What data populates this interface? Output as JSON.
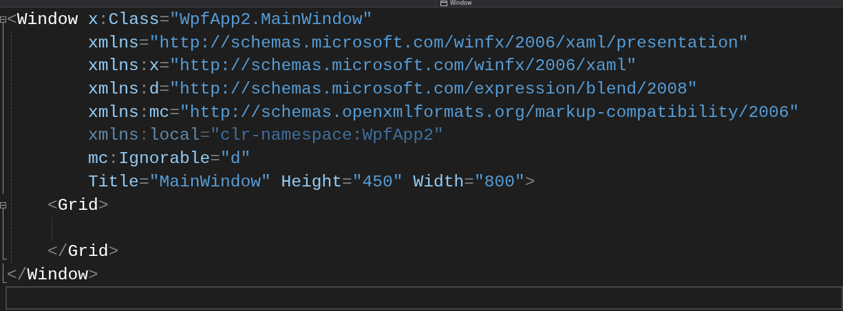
{
  "navigation_bar": {
    "member_dropdown": "Window"
  },
  "editor": {
    "lines": [
      {
        "kind": "root",
        "fold_marker": true,
        "region_end": false,
        "current": false,
        "dimmed": false,
        "tokens": [
          {
            "kind": "punct",
            "text": "<"
          },
          {
            "kind": "tag",
            "text": "Window"
          },
          {
            "kind": "attr",
            "text": "x"
          },
          {
            "kind": "punct",
            "text": ":"
          },
          {
            "kind": "attr",
            "text": "Class"
          },
          {
            "kind": "punct",
            "text": "="
          },
          {
            "kind": "value",
            "text": "\"WpfApp2.MainWindow\""
          }
        ]
      },
      {
        "kind": "attribute",
        "fold_marker": false,
        "region_end": false,
        "current": false,
        "dimmed": false,
        "tokens": [
          {
            "kind": "attr",
            "text": "xmlns"
          },
          {
            "kind": "punct",
            "text": "="
          },
          {
            "kind": "value",
            "text": "\"http://schemas.microsoft.com/winfx/2006/xaml/presentation\""
          }
        ]
      },
      {
        "kind": "attribute",
        "fold_marker": false,
        "region_end": false,
        "current": false,
        "dimmed": false,
        "tokens": [
          {
            "kind": "attr",
            "text": "xmlns"
          },
          {
            "kind": "punct",
            "text": ":"
          },
          {
            "kind": "attr",
            "text": "x"
          },
          {
            "kind": "punct",
            "text": "="
          },
          {
            "kind": "value",
            "text": "\"http://schemas.microsoft.com/winfx/2006/xaml\""
          }
        ]
      },
      {
        "kind": "attribute",
        "fold_marker": false,
        "region_end": false,
        "current": false,
        "dimmed": false,
        "tokens": [
          {
            "kind": "attr",
            "text": "xmlns"
          },
          {
            "kind": "punct",
            "text": ":"
          },
          {
            "kind": "attr",
            "text": "d"
          },
          {
            "kind": "punct",
            "text": "="
          },
          {
            "kind": "value",
            "text": "\"http://schemas.microsoft.com/expression/blend/2008\""
          }
        ]
      },
      {
        "kind": "attribute",
        "fold_marker": false,
        "region_end": false,
        "current": false,
        "dimmed": false,
        "tokens": [
          {
            "kind": "attr",
            "text": "xmlns"
          },
          {
            "kind": "punct",
            "text": ":"
          },
          {
            "kind": "attr",
            "text": "mc"
          },
          {
            "kind": "punct",
            "text": "="
          },
          {
            "kind": "value",
            "text": "\"http://schemas.openxmlformats.org/markup-compatibility/2006\""
          }
        ]
      },
      {
        "kind": "attribute",
        "fold_marker": false,
        "region_end": false,
        "current": false,
        "dimmed": true,
        "tokens": [
          {
            "kind": "attr",
            "text": "xmlns"
          },
          {
            "kind": "punct",
            "text": ":"
          },
          {
            "kind": "attr",
            "text": "local"
          },
          {
            "kind": "punct",
            "text": "="
          },
          {
            "kind": "value",
            "text": "\"clr-namespace:WpfApp2\""
          }
        ]
      },
      {
        "kind": "attribute",
        "fold_marker": false,
        "region_end": false,
        "current": false,
        "dimmed": false,
        "tokens": [
          {
            "kind": "attr",
            "text": "mc"
          },
          {
            "kind": "punct",
            "text": ":"
          },
          {
            "kind": "attr",
            "text": "Ignorable"
          },
          {
            "kind": "punct",
            "text": "="
          },
          {
            "kind": "value",
            "text": "\"d\""
          }
        ]
      },
      {
        "kind": "attribute",
        "fold_marker": false,
        "region_end": false,
        "current": false,
        "dimmed": false,
        "tokens": [
          {
            "kind": "attr",
            "text": "Title"
          },
          {
            "kind": "punct",
            "text": "="
          },
          {
            "kind": "value",
            "text": "\"MainWindow\""
          },
          {
            "kind": "attr",
            "text": "Height"
          },
          {
            "kind": "punct",
            "text": "="
          },
          {
            "kind": "value",
            "text": "\"450\""
          },
          {
            "kind": "attr",
            "text": "Width"
          },
          {
            "kind": "punct",
            "text": "="
          },
          {
            "kind": "value",
            "text": "\"800\""
          },
          {
            "kind": "punct",
            "text": ">"
          }
        ]
      },
      {
        "kind": "child",
        "fold_marker": true,
        "region_end": false,
        "current": false,
        "dimmed": false,
        "tokens": [
          {
            "kind": "punct",
            "text": "<"
          },
          {
            "kind": "tag",
            "text": "Grid"
          },
          {
            "kind": "punct",
            "text": ">"
          }
        ]
      },
      {
        "fold_marker": false,
        "region_end": false
      },
      {
        "kind": "child",
        "fold_marker": false,
        "region_end": true,
        "current": false,
        "dimmed": false,
        "tokens": [
          {
            "kind": "punct",
            "text": "</"
          },
          {
            "kind": "tag",
            "text": "Grid"
          },
          {
            "kind": "punct",
            "text": ">"
          }
        ]
      },
      {
        "kind": "root",
        "fold_marker": false,
        "region_end": true,
        "current": false,
        "dimmed": false,
        "tokens": [
          {
            "kind": "punct",
            "text": "</"
          },
          {
            "kind": "tag",
            "text": "Window"
          },
          {
            "kind": "punct",
            "text": ">"
          }
        ]
      },
      {
        "current": true
      }
    ]
  }
}
